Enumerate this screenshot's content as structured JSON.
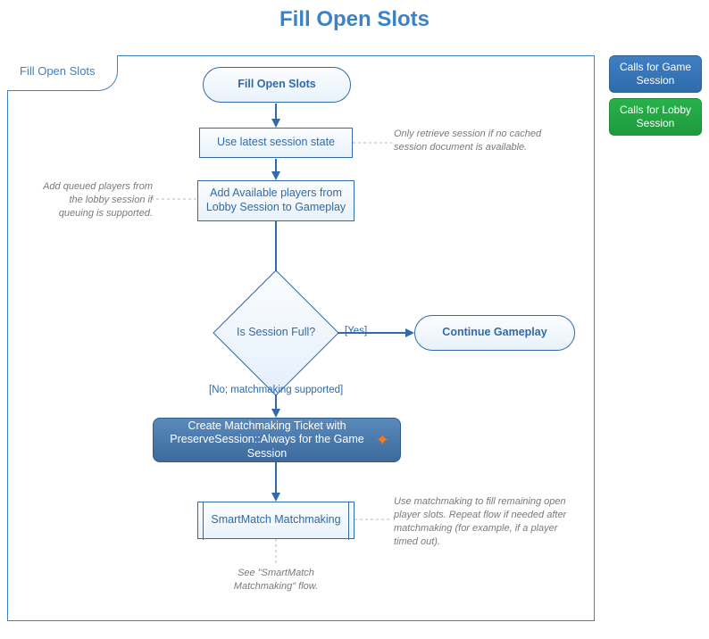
{
  "title": "Fill Open Slots",
  "frame_label": "Fill Open Slots",
  "legend": {
    "game": "Calls for Game Session",
    "lobby": "Calls for Lobby Session"
  },
  "nodes": {
    "start": "Fill Open Slots",
    "use_state": "Use latest session state",
    "add_players": "Add Available players from Lobby Session to Gameplay",
    "decision": "Is Session Full?",
    "continue": "Continue Gameplay",
    "create_ticket": "Create Matchmaking Ticket with PreserveSession::Always for the Game Session",
    "smartmatch": "SmartMatch Matchmaking"
  },
  "edge_labels": {
    "yes": "[Yes]",
    "no": "[No; matchmaking supported]"
  },
  "annotations": {
    "retrieve": "Only retrieve session if no cached session document is available.",
    "queued": "Add queued players from the lobby session if queuing is supported.",
    "use_mm": "Use matchmaking to fill remaining open player slots. Repeat flow if needed after matchmaking (for example, if a player timed out).",
    "see_flow": "See \"SmartMatch Matchmaking\" flow."
  }
}
